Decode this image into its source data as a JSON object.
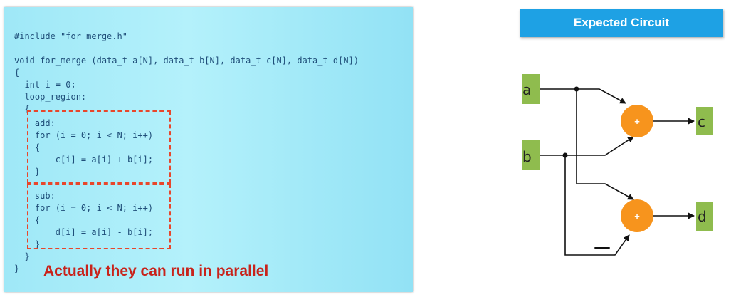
{
  "code": {
    "lines": [
      "#include \"for_merge.h\"",
      "void for_merge (data_t a[N], data_t b[N], data_t c[N], data_t d[N])",
      "{",
      "  int i = 0;",
      "  loop_region:",
      "  {",
      "    add:",
      "    for (i = 0; i < N; i++)",
      "    {",
      "        c[i] = a[i] + b[i];",
      "    }",
      "    sub:",
      "    for (i = 0; i < N; i++)",
      "    {",
      "        d[i] = a[i] - b[i];",
      "    }",
      "  }",
      "}"
    ],
    "note": "Actually they can run in parallel"
  },
  "circuit": {
    "title": "Expected Circuit",
    "inputs": [
      "a",
      "b"
    ],
    "outputs": [
      "c",
      "d"
    ],
    "adder_label": "+",
    "subtractor_label": "+",
    "negate_mark": "—",
    "colors": {
      "title_bar": "#1ea1e4",
      "port": "#8fbc4e",
      "operator": "#f7941d",
      "dash_box": "#e8462b",
      "note": "#c8231b",
      "code_text": "#1f4e79"
    }
  }
}
